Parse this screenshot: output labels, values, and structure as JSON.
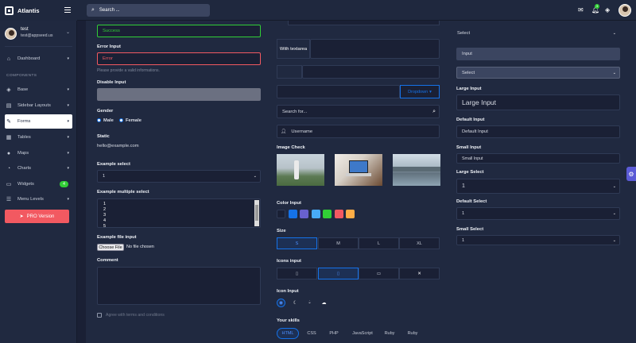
{
  "app": {
    "brand": "Atlantis"
  },
  "header": {
    "search_placeholder": "Search ...",
    "notification_count": "3"
  },
  "user": {
    "name": "test",
    "email": "test@appseed.us"
  },
  "sidebar": {
    "section_label": "COMPONENTS",
    "items": [
      {
        "label": "Dashboard",
        "icon": "home-icon"
      },
      {
        "label": "Base",
        "icon": "layers-icon"
      },
      {
        "label": "Sidebar Layouts",
        "icon": "sidebar-icon"
      },
      {
        "label": "Forms",
        "icon": "pen-square-icon"
      },
      {
        "label": "Tables",
        "icon": "table-icon"
      },
      {
        "label": "Maps",
        "icon": "map-marker-icon"
      },
      {
        "label": "Charts",
        "icon": "chart-icon"
      },
      {
        "label": "Widgets",
        "icon": "desktop-icon",
        "badge": "4"
      },
      {
        "label": "Menu Levels",
        "icon": "list-icon"
      }
    ],
    "pro_label": "PRO Version"
  },
  "left": {
    "success_value": "Success",
    "error_label": "Error Input",
    "error_value": "Error",
    "error_help": "Please provide a valid informations.",
    "disabled_label": "Disable Input",
    "gender_label": "Gender",
    "gender_options": [
      "Male",
      "Female"
    ],
    "static_label": "Static",
    "static_value": "hello@example.com",
    "example_select_label": "Example select",
    "example_select_value": "1",
    "multi_label": "Example multiple select",
    "multi_options": [
      "1",
      "2",
      "3",
      "4",
      "5"
    ],
    "file_label": "Example file input",
    "file_button": "Choose File",
    "file_status": "No file chosen",
    "comment_label": "Comment",
    "agree_label": "Agree with terms and conditions"
  },
  "middle": {
    "textarea_label": "With textarea",
    "dropdown_label": "Dropdown",
    "search_placeholder": "Search for...",
    "username_placeholder": "Username",
    "image_check_label": "Image Check",
    "color_label": "Color Input",
    "colors": [
      "#1a2035",
      "#1572e8",
      "#6861ce",
      "#48abf7",
      "#31ce36",
      "#f25961",
      "#ffad46"
    ],
    "size_label": "Size",
    "sizes": [
      "S",
      "M",
      "L",
      "XL"
    ],
    "icons_label": "Icons input",
    "icon_input_label": "Icon Input",
    "skills_label": "Your skills",
    "skills": [
      "HTML",
      "CSS",
      "PHP",
      "JavaScript",
      "Ruby",
      "Ruby"
    ]
  },
  "right": {
    "select_top": "Select",
    "input_value": "Input",
    "select_value": "Select",
    "large_input_label": "Large Input",
    "large_input_value": "Large Input",
    "default_input_label": "Default Input",
    "default_input_value": "Default Input",
    "small_input_label": "Small Input",
    "small_input_value": "Small Input",
    "large_select_label": "Large Select",
    "large_select_value": "1",
    "default_select_label": "Default Select",
    "default_select_value": "1",
    "small_select_label": "Small Select",
    "small_select_value": "1"
  }
}
